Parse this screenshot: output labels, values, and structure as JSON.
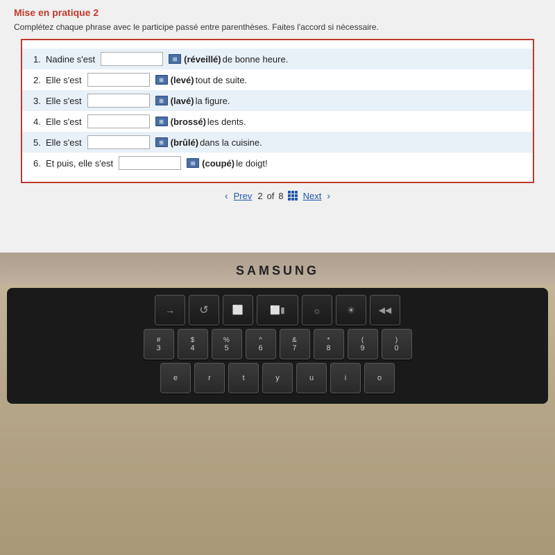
{
  "page": {
    "section_title": "Mise en pratique 2",
    "instruction": "Complétez chaque phrase avec le participe passé entre parenthèses. Faites l'accord si nécessaire.",
    "exercises": [
      {
        "num": "1.",
        "before": "Nadine s'est",
        "hint": "(réveillé)",
        "after": "de bonne heure.",
        "input_value": ""
      },
      {
        "num": "2.",
        "before": "Elle s'est",
        "hint": "(levé)",
        "after": "tout de suite.",
        "input_value": ""
      },
      {
        "num": "3.",
        "before": "Elle s'est",
        "hint": "(lavé)",
        "after": "la figure.",
        "input_value": ""
      },
      {
        "num": "4.",
        "before": "Elle s'est",
        "hint": "(brossé)",
        "after": "les dents.",
        "input_value": ""
      },
      {
        "num": "5.",
        "before": "Elle s'est",
        "hint": "(brûlé)",
        "after": "dans la cuisine.",
        "input_value": ""
      },
      {
        "num": "6.",
        "before": "Et puis, elle s'est",
        "hint": "(coupé)",
        "after": "le doigt!",
        "input_value": ""
      }
    ],
    "nav": {
      "prev_label": "Prev",
      "next_label": "Next",
      "page_current": "2",
      "page_total": "8"
    },
    "laptop": {
      "brand": "SAMSUNG"
    },
    "keyboard": {
      "row1": [
        {
          "symbol": "→",
          "label": ""
        },
        {
          "symbol": "C",
          "label": ""
        },
        {
          "symbol": "⬜",
          "label": ""
        },
        {
          "symbol": "⬜▮",
          "label": ""
        },
        {
          "symbol": "☼",
          "label": ""
        },
        {
          "symbol": "☀",
          "label": ""
        },
        {
          "symbol": "◀",
          "label": ""
        }
      ],
      "row2": [
        {
          "top": "#",
          "bottom": "3"
        },
        {
          "top": "$",
          "bottom": "4"
        },
        {
          "top": "%",
          "bottom": "5"
        },
        {
          "top": "^",
          "bottom": "6"
        },
        {
          "top": "&",
          "bottom": "7"
        },
        {
          "top": "*",
          "bottom": "8"
        },
        {
          "top": "(",
          "bottom": "9"
        },
        {
          "top": ")",
          "bottom": "0"
        }
      ],
      "row3": [
        {
          "label": "e"
        },
        {
          "label": "r"
        },
        {
          "label": "t"
        },
        {
          "label": "y"
        },
        {
          "label": "u"
        },
        {
          "label": "i"
        },
        {
          "label": "o"
        }
      ]
    }
  }
}
